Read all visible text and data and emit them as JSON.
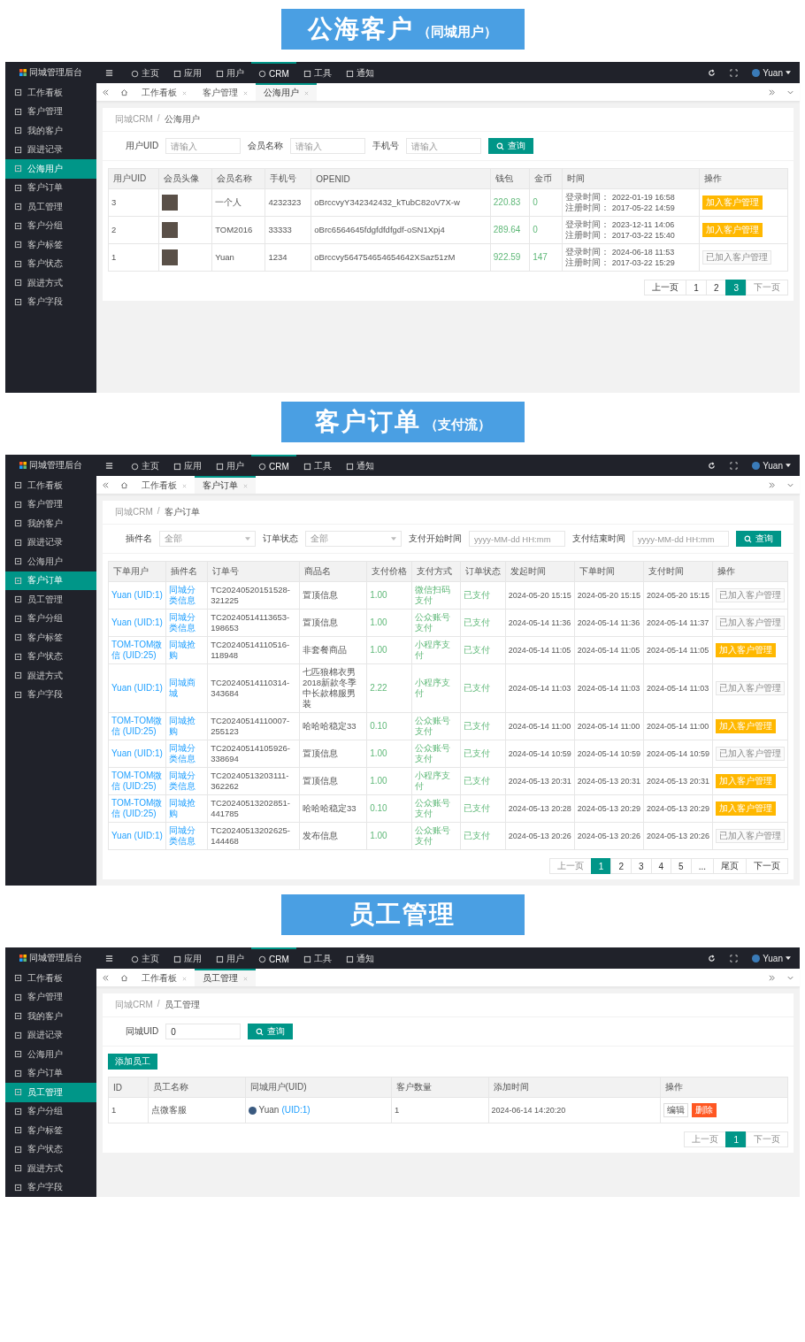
{
  "sections": [
    {
      "banner": {
        "title": "公海客户",
        "subtitle": "（同城用户）"
      },
      "brand": "同城管理后台",
      "top_nav": [
        {
          "label": "主页",
          "selected": false
        },
        {
          "label": "应用",
          "selected": false
        },
        {
          "label": "用户",
          "selected": false
        },
        {
          "label": "CRM",
          "selected": true
        },
        {
          "label": "工具",
          "selected": false
        },
        {
          "label": "通知",
          "selected": false
        }
      ],
      "user_name": "Yuan",
      "sidebar": [
        {
          "label": "工作看板",
          "selected": false
        },
        {
          "label": "客户管理",
          "selected": false
        },
        {
          "label": "我的客户",
          "selected": false
        },
        {
          "label": "跟进记录",
          "selected": false
        },
        {
          "label": "公海用户",
          "selected": true
        },
        {
          "label": "客户订单",
          "selected": false
        },
        {
          "label": "员工管理",
          "selected": false
        },
        {
          "label": "客户分组",
          "selected": false
        },
        {
          "label": "客户标签",
          "selected": false
        },
        {
          "label": "客户状态",
          "selected": false
        },
        {
          "label": "跟进方式",
          "selected": false
        },
        {
          "label": "客户字段",
          "selected": false
        }
      ],
      "tabs": [
        {
          "label": "工作看板",
          "selected": false
        },
        {
          "label": "客户管理",
          "selected": false
        },
        {
          "label": "公海用户",
          "selected": true
        }
      ],
      "breadcrumb": [
        "同城CRM",
        "公海用户"
      ],
      "breadcrumb_separator": "/",
      "filters": [
        {
          "kind": "input",
          "label": "用户UID",
          "placeholder": "请输入"
        },
        {
          "kind": "input",
          "label": "会员名称",
          "placeholder": "请输入"
        },
        {
          "kind": "input",
          "label": "手机号",
          "placeholder": "请输入"
        }
      ],
      "search_button": "查询",
      "table": {
        "columns": [
          "用户UID",
          "会员头像",
          "会员名称",
          "手机号",
          "OPENID",
          "钱包",
          "金币",
          "时间",
          "操作"
        ],
        "rows": [
          [
            {
              "kind": "text",
              "text": "3"
            },
            {
              "kind": "avatar"
            },
            {
              "kind": "text",
              "text": "一个人"
            },
            {
              "kind": "text",
              "text": "4232323"
            },
            {
              "kind": "text",
              "text": "oBrccvyY342342432_kTubC82oV7X-w"
            },
            {
              "kind": "green",
              "text": "220.83"
            },
            {
              "kind": "green",
              "text": "0"
            },
            {
              "kind": "times",
              "lines": [
                {
                  "label": "登录时间：",
                  "value": "2022-01-19 16:58"
                },
                {
                  "label": "注册时间：",
                  "value": "2017-05-22 14:59"
                }
              ]
            },
            {
              "kind": "action",
              "buttons": [
                {
                  "kind": "add",
                  "label": "加入客户管理"
                }
              ]
            }
          ],
          [
            {
              "kind": "text",
              "text": "2"
            },
            {
              "kind": "avatar"
            },
            {
              "kind": "text",
              "text": "TOM2016"
            },
            {
              "kind": "text",
              "text": "33333"
            },
            {
              "kind": "text",
              "text": "oBrc6564645fdgfdfdfgdf-oSN1Xpj4"
            },
            {
              "kind": "green",
              "text": "289.64"
            },
            {
              "kind": "green",
              "text": "0"
            },
            {
              "kind": "times",
              "lines": [
                {
                  "label": "登录时间：",
                  "value": "2023-12-11 14:06"
                },
                {
                  "label": "注册时间：",
                  "value": "2017-03-22 15:40"
                }
              ]
            },
            {
              "kind": "action",
              "buttons": [
                {
                  "kind": "add",
                  "label": "加入客户管理"
                }
              ]
            }
          ],
          [
            {
              "kind": "text",
              "text": "1"
            },
            {
              "kind": "avatar"
            },
            {
              "kind": "text",
              "text": "Yuan"
            },
            {
              "kind": "text",
              "text": "1234"
            },
            {
              "kind": "text",
              "text": "oBrccvy564754654654642XSaz51zM"
            },
            {
              "kind": "green",
              "text": "922.59"
            },
            {
              "kind": "green",
              "text": "147"
            },
            {
              "kind": "times",
              "lines": [
                {
                  "label": "登录时间：",
                  "value": "2024-06-18 11:53"
                },
                {
                  "label": "注册时间：",
                  "value": "2017-03-22 15:29"
                }
              ]
            },
            {
              "kind": "action",
              "buttons": [
                {
                  "kind": "added",
                  "label": "已加入客户管理"
                }
              ]
            }
          ]
        ]
      },
      "pagination": [
        {
          "label": "上一页",
          "selected": false,
          "disabled": false
        },
        {
          "label": "1",
          "selected": false,
          "disabled": false
        },
        {
          "label": "2",
          "selected": false,
          "disabled": false
        },
        {
          "label": "3",
          "selected": true,
          "disabled": false
        },
        {
          "label": "下一页",
          "selected": false,
          "disabled": true
        }
      ]
    },
    {
      "banner": {
        "title": "客户订单",
        "subtitle": "（支付流）"
      },
      "brand": "同城管理后台",
      "top_nav": [
        {
          "label": "主页",
          "selected": false
        },
        {
          "label": "应用",
          "selected": false
        },
        {
          "label": "用户",
          "selected": false
        },
        {
          "label": "CRM",
          "selected": true
        },
        {
          "label": "工具",
          "selected": false
        },
        {
          "label": "通知",
          "selected": false
        }
      ],
      "user_name": "Yuan",
      "sidebar": [
        {
          "label": "工作看板",
          "selected": false
        },
        {
          "label": "客户管理",
          "selected": false
        },
        {
          "label": "我的客户",
          "selected": false
        },
        {
          "label": "跟进记录",
          "selected": false
        },
        {
          "label": "公海用户",
          "selected": false
        },
        {
          "label": "客户订单",
          "selected": true
        },
        {
          "label": "员工管理",
          "selected": false
        },
        {
          "label": "客户分组",
          "selected": false
        },
        {
          "label": "客户标签",
          "selected": false
        },
        {
          "label": "客户状态",
          "selected": false
        },
        {
          "label": "跟进方式",
          "selected": false
        },
        {
          "label": "客户字段",
          "selected": false
        }
      ],
      "tabs": [
        {
          "label": "工作看板",
          "selected": false
        },
        {
          "label": "客户订单",
          "selected": true
        }
      ],
      "breadcrumb": [
        "同城CRM",
        "客户订单"
      ],
      "breadcrumb_separator": "/",
      "filters": [
        {
          "kind": "select",
          "label": "插件名",
          "placeholder": "全部"
        },
        {
          "kind": "select",
          "label": "订单状态",
          "placeholder": "全部"
        },
        {
          "kind": "input",
          "label": "支付开始时间",
          "placeholder": "yyyy-MM-dd HH:mm"
        },
        {
          "kind": "input",
          "label": "支付结束时间",
          "placeholder": "yyyy-MM-dd HH:mm"
        }
      ],
      "search_button": "查询",
      "table": {
        "columns": [
          "下单用户",
          "插件名",
          "订单号",
          "商品名",
          "支付价格",
          "支付方式",
          "订单状态",
          "发起时间",
          "下单时间",
          "支付时间",
          "操作"
        ],
        "rows": [
          [
            {
              "kind": "link",
              "text": "Yuan (UID:1)"
            },
            {
              "kind": "link",
              "text": "同城分类信息"
            },
            {
              "kind": "text",
              "text": "TC20240520151528-321225"
            },
            {
              "kind": "text",
              "text": "置顶信息"
            },
            {
              "kind": "green",
              "text": "1.00"
            },
            {
              "kind": "green",
              "text": "微信扫码支付"
            },
            {
              "kind": "green",
              "text": "已支付"
            },
            {
              "kind": "date",
              "text": "2024-05-20 15:15"
            },
            {
              "kind": "date",
              "text": "2024-05-20 15:15"
            },
            {
              "kind": "date",
              "text": "2024-05-20 15:15"
            },
            {
              "kind": "action",
              "buttons": [
                {
                  "kind": "added",
                  "label": "已加入客户管理"
                }
              ]
            }
          ],
          [
            {
              "kind": "link",
              "text": "Yuan (UID:1)"
            },
            {
              "kind": "link",
              "text": "同城分类信息"
            },
            {
              "kind": "text",
              "text": "TC20240514113653-198653"
            },
            {
              "kind": "text",
              "text": "置顶信息"
            },
            {
              "kind": "green",
              "text": "1.00"
            },
            {
              "kind": "green",
              "text": "公众账号支付"
            },
            {
              "kind": "green",
              "text": "已支付"
            },
            {
              "kind": "date",
              "text": "2024-05-14 11:36"
            },
            {
              "kind": "date",
              "text": "2024-05-14 11:36"
            },
            {
              "kind": "date",
              "text": "2024-05-14 11:37"
            },
            {
              "kind": "action",
              "buttons": [
                {
                  "kind": "added",
                  "label": "已加入客户管理"
                }
              ]
            }
          ],
          [
            {
              "kind": "link",
              "text": "TOM-TOM微信 (UID:25)"
            },
            {
              "kind": "link",
              "text": "同城抢购"
            },
            {
              "kind": "text",
              "text": "TC20240514110516-118948"
            },
            {
              "kind": "text",
              "text": "非套餐商品"
            },
            {
              "kind": "green",
              "text": "1.00"
            },
            {
              "kind": "green",
              "text": "小程序支付"
            },
            {
              "kind": "green",
              "text": "已支付"
            },
            {
              "kind": "date",
              "text": "2024-05-14 11:05"
            },
            {
              "kind": "date",
              "text": "2024-05-14 11:05"
            },
            {
              "kind": "date",
              "text": "2024-05-14 11:05"
            },
            {
              "kind": "action",
              "buttons": [
                {
                  "kind": "add",
                  "label": "加入客户管理"
                }
              ]
            }
          ],
          [
            {
              "kind": "link",
              "text": "Yuan (UID:1)"
            },
            {
              "kind": "link",
              "text": "同城商城"
            },
            {
              "kind": "text",
              "text": "TC20240514110314-343684"
            },
            {
              "kind": "text",
              "text": "七匹狼棉衣男2018新款冬季中长款棉服男装"
            },
            {
              "kind": "green",
              "text": "2.22"
            },
            {
              "kind": "green",
              "text": "小程序支付"
            },
            {
              "kind": "green",
              "text": "已支付"
            },
            {
              "kind": "date",
              "text": "2024-05-14 11:03"
            },
            {
              "kind": "date",
              "text": "2024-05-14 11:03"
            },
            {
              "kind": "date",
              "text": "2024-05-14 11:03"
            },
            {
              "kind": "action",
              "buttons": [
                {
                  "kind": "added",
                  "label": "已加入客户管理"
                }
              ]
            }
          ],
          [
            {
              "kind": "link",
              "text": "TOM-TOM微信 (UID:25)"
            },
            {
              "kind": "link",
              "text": "同城抢购"
            },
            {
              "kind": "text",
              "text": "TC20240514110007-255123"
            },
            {
              "kind": "text",
              "text": "哈哈哈稳定33"
            },
            {
              "kind": "green",
              "text": "0.10"
            },
            {
              "kind": "green",
              "text": "公众账号支付"
            },
            {
              "kind": "green",
              "text": "已支付"
            },
            {
              "kind": "date",
              "text": "2024-05-14 11:00"
            },
            {
              "kind": "date",
              "text": "2024-05-14 11:00"
            },
            {
              "kind": "date",
              "text": "2024-05-14 11:00"
            },
            {
              "kind": "action",
              "buttons": [
                {
                  "kind": "add",
                  "label": "加入客户管理"
                }
              ]
            }
          ],
          [
            {
              "kind": "link",
              "text": "Yuan (UID:1)"
            },
            {
              "kind": "link",
              "text": "同城分类信息"
            },
            {
              "kind": "text",
              "text": "TC20240514105926-338694"
            },
            {
              "kind": "text",
              "text": "置顶信息"
            },
            {
              "kind": "green",
              "text": "1.00"
            },
            {
              "kind": "green",
              "text": "公众账号支付"
            },
            {
              "kind": "green",
              "text": "已支付"
            },
            {
              "kind": "date",
              "text": "2024-05-14 10:59"
            },
            {
              "kind": "date",
              "text": "2024-05-14 10:59"
            },
            {
              "kind": "date",
              "text": "2024-05-14 10:59"
            },
            {
              "kind": "action",
              "buttons": [
                {
                  "kind": "added",
                  "label": "已加入客户管理"
                }
              ]
            }
          ],
          [
            {
              "kind": "link",
              "text": "TOM-TOM微信 (UID:25)"
            },
            {
              "kind": "link",
              "text": "同城分类信息"
            },
            {
              "kind": "text",
              "text": "TC20240513203111-362262"
            },
            {
              "kind": "text",
              "text": "置顶信息"
            },
            {
              "kind": "green",
              "text": "1.00"
            },
            {
              "kind": "green",
              "text": "小程序支付"
            },
            {
              "kind": "green",
              "text": "已支付"
            },
            {
              "kind": "date",
              "text": "2024-05-13 20:31"
            },
            {
              "kind": "date",
              "text": "2024-05-13 20:31"
            },
            {
              "kind": "date",
              "text": "2024-05-13 20:31"
            },
            {
              "kind": "action",
              "buttons": [
                {
                  "kind": "add",
                  "label": "加入客户管理"
                }
              ]
            }
          ],
          [
            {
              "kind": "link",
              "text": "TOM-TOM微信 (UID:25)"
            },
            {
              "kind": "link",
              "text": "同城抢购"
            },
            {
              "kind": "text",
              "text": "TC20240513202851-441785"
            },
            {
              "kind": "text",
              "text": "哈哈哈稳定33"
            },
            {
              "kind": "green",
              "text": "0.10"
            },
            {
              "kind": "green",
              "text": "公众账号支付"
            },
            {
              "kind": "green",
              "text": "已支付"
            },
            {
              "kind": "date",
              "text": "2024-05-13 20:28"
            },
            {
              "kind": "date",
              "text": "2024-05-13 20:29"
            },
            {
              "kind": "date",
              "text": "2024-05-13 20:29"
            },
            {
              "kind": "action",
              "buttons": [
                {
                  "kind": "add",
                  "label": "加入客户管理"
                }
              ]
            }
          ],
          [
            {
              "kind": "link",
              "text": "Yuan (UID:1)"
            },
            {
              "kind": "link",
              "text": "同城分类信息"
            },
            {
              "kind": "text",
              "text": "TC20240513202625-144468"
            },
            {
              "kind": "text",
              "text": "发布信息"
            },
            {
              "kind": "green",
              "text": "1.00"
            },
            {
              "kind": "green",
              "text": "公众账号支付"
            },
            {
              "kind": "green",
              "text": "已支付"
            },
            {
              "kind": "date",
              "text": "2024-05-13 20:26"
            },
            {
              "kind": "date",
              "text": "2024-05-13 20:26"
            },
            {
              "kind": "date",
              "text": "2024-05-13 20:26"
            },
            {
              "kind": "action",
              "buttons": [
                {
                  "kind": "added",
                  "label": "已加入客户管理"
                }
              ]
            }
          ]
        ]
      },
      "pagination": [
        {
          "label": "上一页",
          "selected": false,
          "disabled": true
        },
        {
          "label": "1",
          "selected": true,
          "disabled": false
        },
        {
          "label": "2",
          "selected": false,
          "disabled": false
        },
        {
          "label": "3",
          "selected": false,
          "disabled": false
        },
        {
          "label": "4",
          "selected": false,
          "disabled": false
        },
        {
          "label": "5",
          "selected": false,
          "disabled": false
        },
        {
          "label": "...",
          "selected": false,
          "disabled": false
        },
        {
          "label": "尾页",
          "selected": false,
          "disabled": false
        },
        {
          "label": "下一页",
          "selected": false,
          "disabled": false
        }
      ]
    },
    {
      "banner": {
        "title": "员工管理"
      },
      "brand": "同城管理后台",
      "top_nav": [
        {
          "label": "主页",
          "selected": false
        },
        {
          "label": "应用",
          "selected": false
        },
        {
          "label": "用户",
          "selected": false
        },
        {
          "label": "CRM",
          "selected": true
        },
        {
          "label": "工具",
          "selected": false
        },
        {
          "label": "通知",
          "selected": false
        }
      ],
      "user_name": "Yuan",
      "sidebar": [
        {
          "label": "工作看板",
          "selected": false
        },
        {
          "label": "客户管理",
          "selected": false
        },
        {
          "label": "我的客户",
          "selected": false
        },
        {
          "label": "跟进记录",
          "selected": false
        },
        {
          "label": "公海用户",
          "selected": false
        },
        {
          "label": "客户订单",
          "selected": false
        },
        {
          "label": "员工管理",
          "selected": true
        },
        {
          "label": "客户分组",
          "selected": false
        },
        {
          "label": "客户标签",
          "selected": false
        },
        {
          "label": "客户状态",
          "selected": false
        },
        {
          "label": "跟进方式",
          "selected": false
        },
        {
          "label": "客户字段",
          "selected": false
        }
      ],
      "tabs": [
        {
          "label": "工作看板",
          "selected": false
        },
        {
          "label": "员工管理",
          "selected": true
        }
      ],
      "breadcrumb": [
        "同城CRM",
        "员工管理"
      ],
      "breadcrumb_separator": "/",
      "filters": [
        {
          "kind": "input",
          "label": "同城UID",
          "value": "0"
        }
      ],
      "search_button": "查询",
      "add_button": "添加员工",
      "table": {
        "columns": [
          "ID",
          "员工名称",
          "同城用户(UID)",
          "客户数量",
          "添加时间",
          "操作"
        ],
        "rows": [
          [
            {
              "kind": "text",
              "text": "1"
            },
            {
              "kind": "text",
              "text": "点微客服"
            },
            {
              "kind": "user",
              "name": "Yuan",
              "uid": "(UID:1)"
            },
            {
              "kind": "text",
              "text": "1"
            },
            {
              "kind": "date",
              "text": "2024-06-14 14:20:20"
            },
            {
              "kind": "action",
              "buttons": [
                {
                  "kind": "edit",
                  "label": "编辑"
                },
                {
                  "kind": "delete",
                  "label": "删除"
                }
              ]
            }
          ]
        ]
      },
      "pagination": [
        {
          "label": "上一页",
          "selected": false,
          "disabled": true
        },
        {
          "label": "1",
          "selected": true,
          "disabled": false
        },
        {
          "label": "下一页",
          "selected": false,
          "disabled": true
        }
      ]
    }
  ]
}
